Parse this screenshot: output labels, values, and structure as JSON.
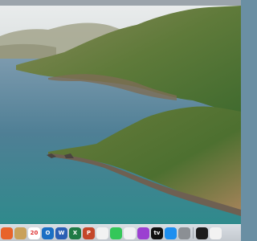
{
  "menubar": {},
  "dock": {
    "items": [
      {
        "icon": "firefox-icon",
        "color": "#e8632a"
      },
      {
        "icon": "notes-icon",
        "color": "#c9a15a"
      },
      {
        "icon": "calendar-icon",
        "color": "#ffffff",
        "text": "20"
      },
      {
        "icon": "outlook-icon",
        "color": "#1a6fc4",
        "text": "O"
      },
      {
        "icon": "word-icon",
        "color": "#2b5fb4",
        "text": "W"
      },
      {
        "icon": "excel-icon",
        "color": "#1f7a45",
        "text": "X"
      },
      {
        "icon": "powerpoint-icon",
        "color": "#c4472a",
        "text": "P"
      },
      {
        "icon": "photos-icon",
        "color": "#f2f2f2"
      },
      {
        "icon": "messages-icon",
        "color": "#34c759"
      },
      {
        "icon": "music-icon",
        "color": "#f1f1f3"
      },
      {
        "icon": "podcasts-icon",
        "color": "#9b3fd1"
      },
      {
        "icon": "apple-tv-icon",
        "color": "#111111",
        "text": "tv"
      },
      {
        "icon": "app-store-icon",
        "color": "#1e8ff0"
      },
      {
        "icon": "system-settings-icon",
        "color": "#8b8f94"
      },
      {
        "icon": "terminal-icon",
        "color": "#1c1c1c"
      },
      {
        "icon": "home-icon",
        "color": "#f2f2f2"
      }
    ]
  }
}
